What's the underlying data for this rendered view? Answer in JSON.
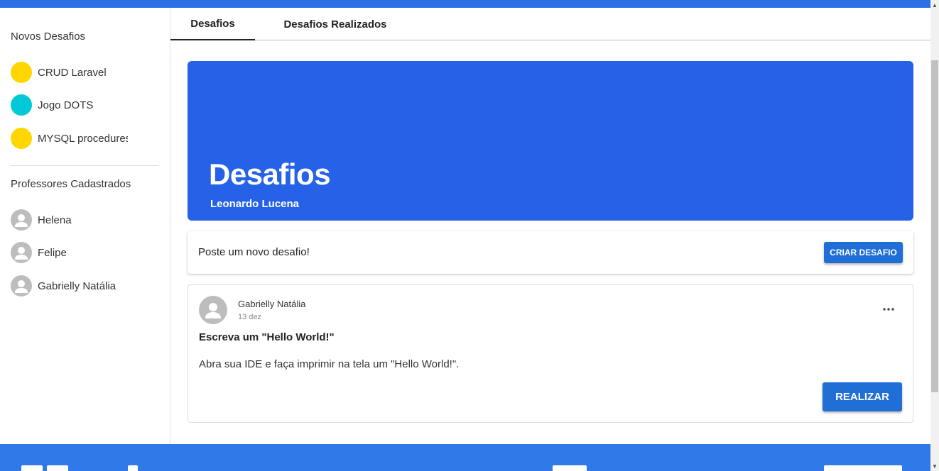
{
  "colors": {
    "topbar": "#2b6fe3",
    "banner": "#2662e8",
    "button": "#1f6fd6",
    "footer": "#2f7ae8",
    "dot_yellow": "#ffd600",
    "dot_cyan": "#00c8d6"
  },
  "sidebar": {
    "new_challenges_heading": "Novos Desafios",
    "challenges": [
      {
        "label": "CRUD Laravel",
        "color": "#ffd600"
      },
      {
        "label": "Jogo DOTS",
        "color": "#00c8d6"
      },
      {
        "label": "MYSQL procedures",
        "color": "#ffd600"
      }
    ],
    "teachers_heading": "Professores Cadastrados",
    "teachers": [
      {
        "name": "Helena",
        "icon": "person-icon"
      },
      {
        "name": "Felipe",
        "icon": "person-icon"
      },
      {
        "name": "Gabrielly Natália",
        "icon": "person-icon"
      }
    ]
  },
  "tabs": [
    {
      "label": "Desafios",
      "active": true
    },
    {
      "label": "Desafios Realizados",
      "active": false
    }
  ],
  "banner": {
    "title": "Desafios",
    "subtitle": "Leonardo Lucena"
  },
  "post_box": {
    "prompt": "Poste um novo desafio!",
    "button_label": "CRIAR DESAFIO"
  },
  "card": {
    "author": "Gabrielly Natália",
    "date": "13 dez",
    "menu_icon": "more-horiz-icon",
    "title": "Escreva um \"Hello World!\"",
    "body": "Abra sua IDE e faça imprimir na tela um \"Hello World!\".",
    "button_label": "REALIZAR"
  }
}
